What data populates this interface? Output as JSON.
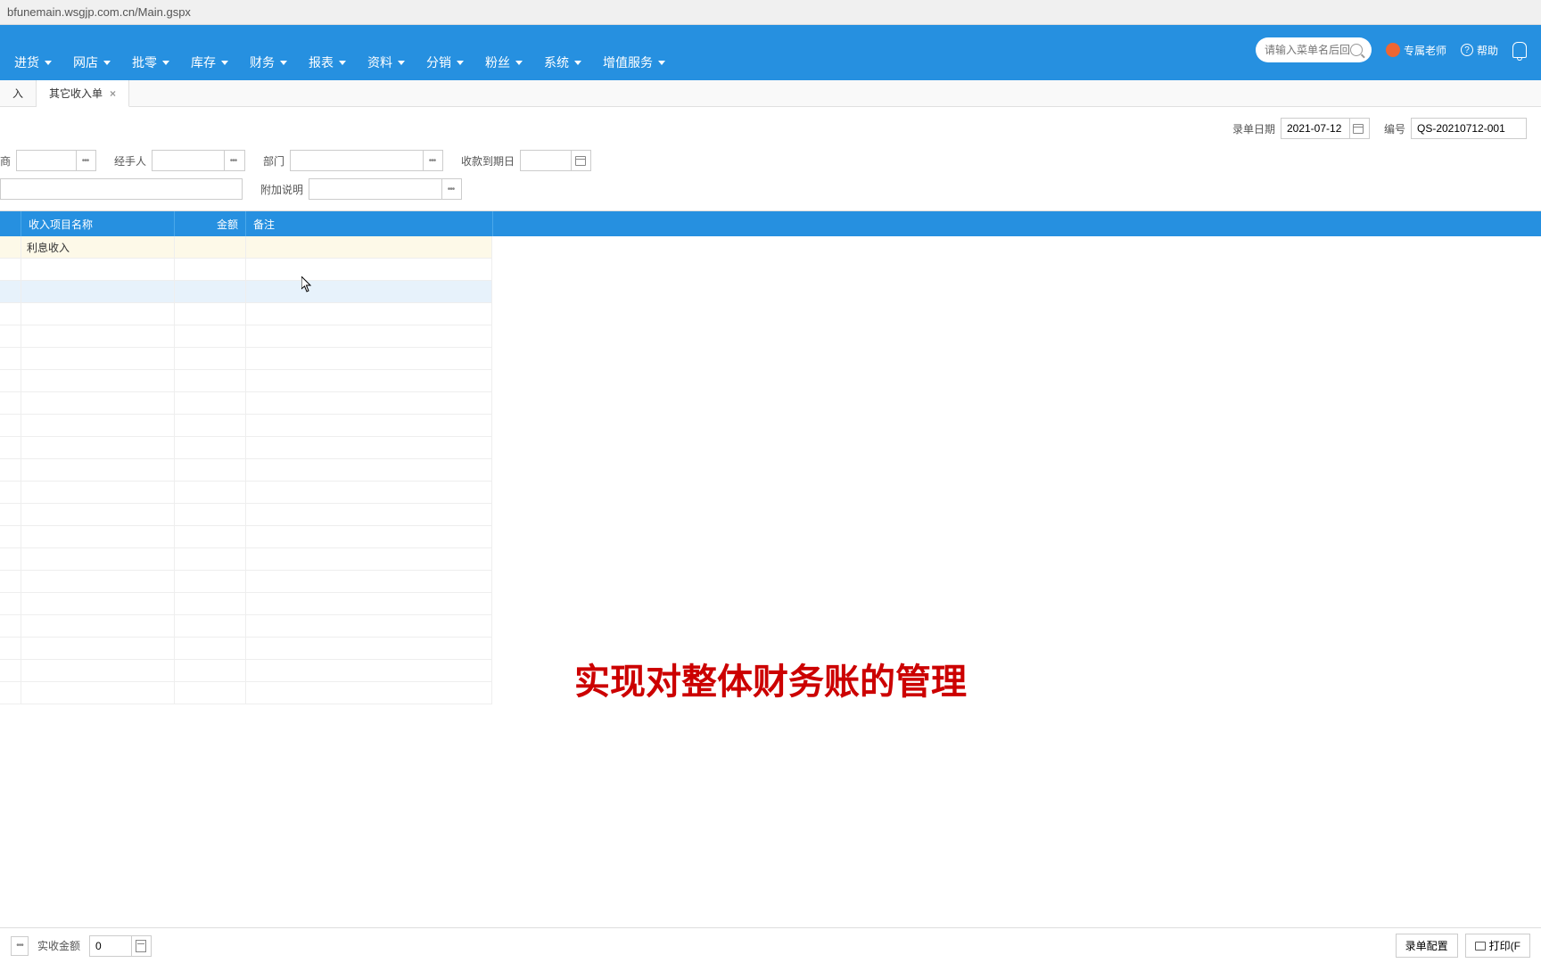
{
  "url": "bfunemain.wsgjp.com.cn/Main.gspx",
  "nav": {
    "items": [
      "进货",
      "网店",
      "批零",
      "库存",
      "财务",
      "报表",
      "资料",
      "分销",
      "粉丝",
      "系统",
      "增值服务"
    ]
  },
  "search": {
    "placeholder": "请输入菜单名后回车"
  },
  "topRight": {
    "teacher": "专属老师",
    "help": "帮助"
  },
  "tabs": {
    "items": [
      {
        "label": "入",
        "active": false
      },
      {
        "label": "其它收入单",
        "active": true
      }
    ]
  },
  "docInfo": {
    "dateLabel": "录单日期",
    "dateValue": "2021-07-12",
    "codeLabel": "编号",
    "codeValue": "QS-20210712-001"
  },
  "form": {
    "supplier": {
      "label": "商"
    },
    "handler": {
      "label": "经手人"
    },
    "dept": {
      "label": "部门"
    },
    "dueDate": {
      "label": "收款到期日"
    },
    "extra": {
      "label": "附加说明"
    }
  },
  "table": {
    "headers": {
      "col1": "",
      "col2": "收入项目名称",
      "col3": "金额",
      "col4": "备注"
    },
    "rows": [
      {
        "name": "利息收入",
        "amount": "",
        "remark": ""
      }
    ]
  },
  "caption": "实现对整体财务账的管理",
  "footer": {
    "receivedLabel": "实收金额",
    "receivedValue": "0",
    "configBtn": "录单配置",
    "printBtn": "打印(F"
  }
}
